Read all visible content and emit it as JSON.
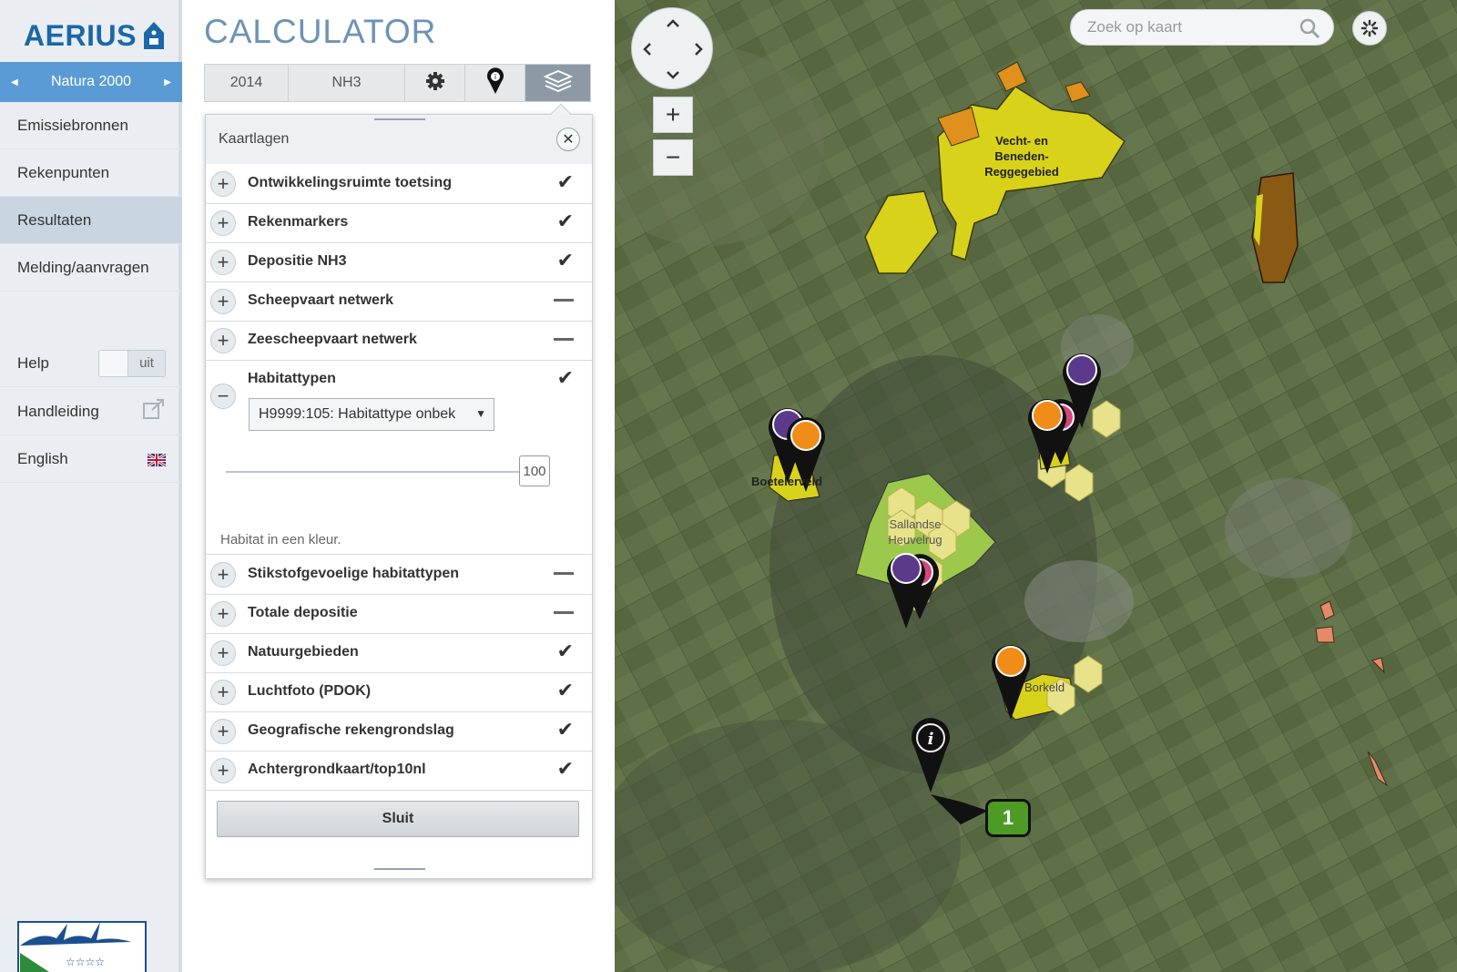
{
  "brand": {
    "name": "AERIUS",
    "product": "CALCULATOR"
  },
  "nav": {
    "scope_label": "Natura 2000",
    "items": [
      {
        "label": "Emissiebronnen"
      },
      {
        "label": "Rekenpunten"
      },
      {
        "label": "Resultaten",
        "active": true
      },
      {
        "label": "Melding/aanvragen"
      }
    ],
    "help": {
      "label": "Help",
      "toggle_value": "uit"
    },
    "manual": {
      "label": "Handleiding"
    },
    "language": {
      "label": "English"
    }
  },
  "toolbar": {
    "year": "2014",
    "substance": "NH3",
    "icons": [
      "gear-icon",
      "map-marker-icon",
      "layers-icon"
    ]
  },
  "layers_panel": {
    "title": "Kaartlagen",
    "close_button": "Sluit",
    "layers": [
      {
        "label": "Ontwikkelingsruimte toetsing",
        "state": "check"
      },
      {
        "label": "Rekenmarkers",
        "state": "check"
      },
      {
        "label": "Depositie NH3",
        "state": "check"
      },
      {
        "label": "Scheepvaart netwerk",
        "state": "dash"
      },
      {
        "label": "Zeescheepvaart netwerk",
        "state": "dash"
      },
      {
        "label": "Habitattypen",
        "state": "check",
        "expanded": true
      },
      {
        "label": "Stikstofgevoelige habitattypen",
        "state": "dash"
      },
      {
        "label": "Totale depositie",
        "state": "dash"
      },
      {
        "label": "Natuurgebieden",
        "state": "check"
      },
      {
        "label": "Luchtfoto (PDOK)",
        "state": "check"
      },
      {
        "label": "Geografische rekengrondslag",
        "state": "check"
      },
      {
        "label": "Achtergrondkaart/top10nl",
        "state": "check"
      }
    ],
    "habitat": {
      "selected": "H9999:105: Habitattype onbek",
      "opacity": "100",
      "note": "Habitat in een kleur."
    }
  },
  "map": {
    "search_placeholder": "Zoek op kaart",
    "zoom_in": "+",
    "zoom_out": "−",
    "labels": {
      "vecht": "Vecht- en Beneden-Reggegebied",
      "boetelerveld": "Boetelerveld",
      "sallandse": "Sallandse Heuvelrug",
      "borkeld": "Borkeld"
    },
    "marker_badge": "1",
    "colors": {
      "habitat_yellow": "#d8d21a",
      "habitat_orange": "#e0901c",
      "habitat_brown": "#8a5a14",
      "marker_purple": "#5b3a8c",
      "marker_orange": "#f08c18",
      "badge_green": "#4d9a25"
    }
  }
}
